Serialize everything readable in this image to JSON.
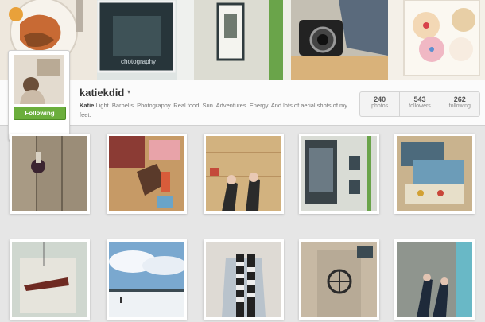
{
  "profile": {
    "username": "katiekdid",
    "follow_button": "Following",
    "bio_name": "Katie",
    "bio_text": "Light. Barbells. Photography. Real food. Sun. Adventures. Energy. And lots of aerial shots of my feet.",
    "stats": [
      {
        "count": "240",
        "label": "photos"
      },
      {
        "count": "543",
        "label": "followers"
      },
      {
        "count": "262",
        "label": "following"
      }
    ]
  },
  "cover": {
    "tiles": [
      "cover-photo-food",
      "cover-photo-framed-print",
      "cover-photo-wall-art",
      "cover-photo-camera",
      "cover-photo-cupcakes"
    ],
    "caption": "chotography"
  },
  "grid": {
    "photos": [
      "photo-wood-table-drink",
      "photo-clothes-flatlay",
      "photo-feet-wood-floor",
      "photo-framed-art-wall",
      "photo-paint-palettes",
      "photo-hanging-ornament",
      "photo-snowy-field-sky",
      "photo-striped-scarf-outfit",
      "photo-tshirt-wheel-print",
      "photo-feet-on-rocks"
    ]
  },
  "colors": {
    "accent_green": "#6bae3c",
    "page_bg": "#e6e6e6"
  }
}
